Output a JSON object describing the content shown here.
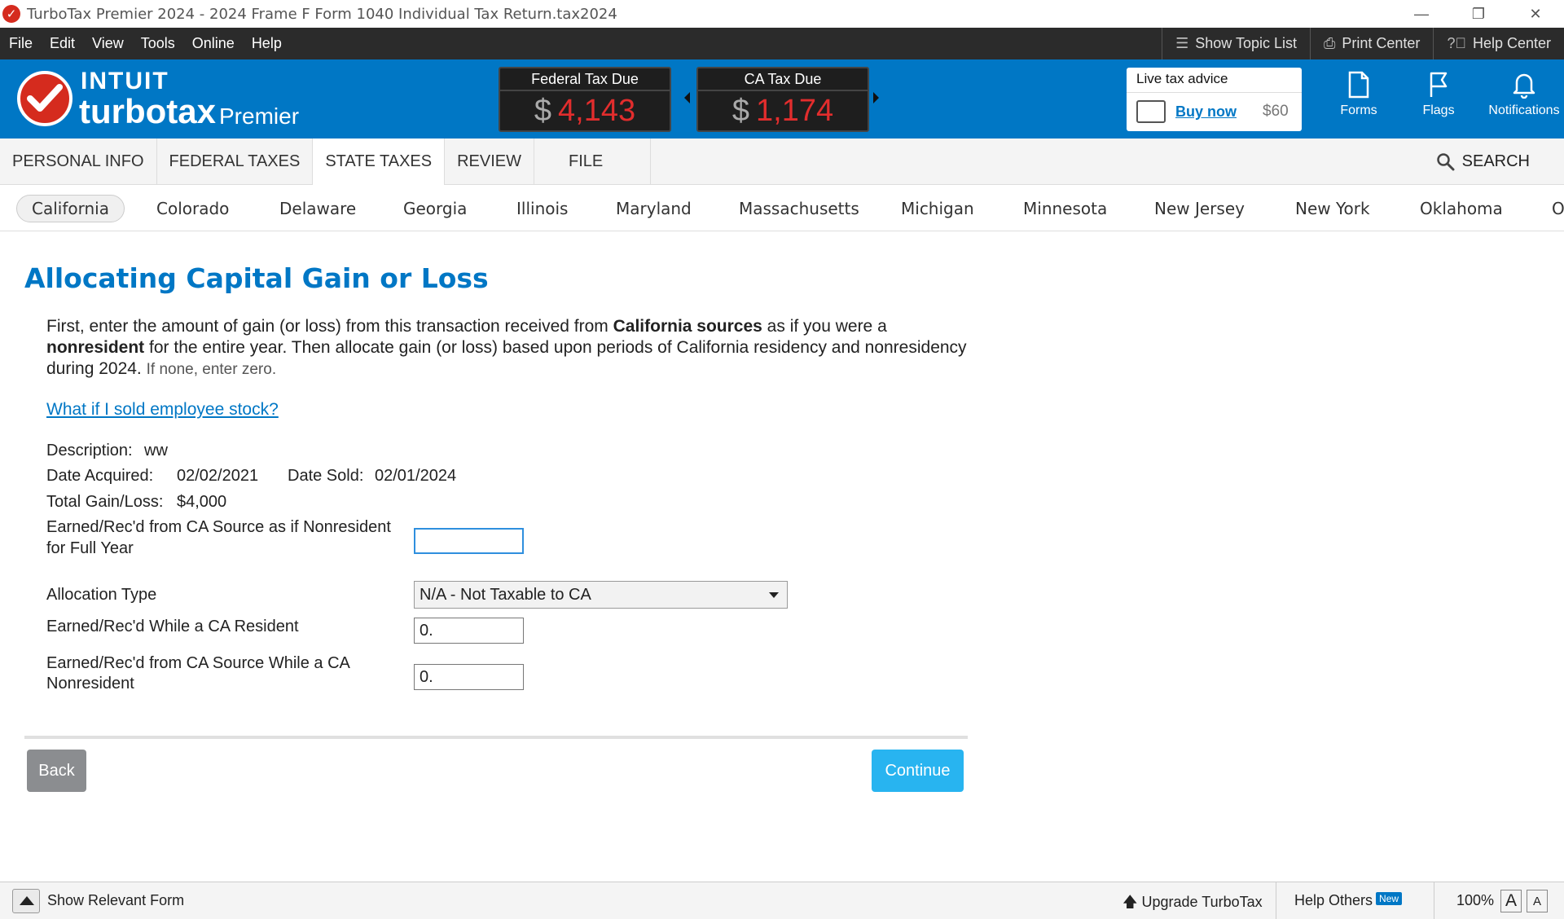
{
  "window": {
    "title": "TurboTax Premier 2024 - 2024 Frame F Form 1040  Individual Tax Return.tax2024",
    "controls": [
      "—",
      "❐",
      "✕"
    ]
  },
  "menu": {
    "items": [
      "File",
      "Edit",
      "View",
      "Tools",
      "Online",
      "Help"
    ],
    "show_topic_list": "Show Topic List",
    "print_center": "Print Center",
    "help_center": "Help Center"
  },
  "brand": {
    "intuit": "INTUIT",
    "turbotax": "turbotax",
    "edition": "Premier"
  },
  "tax_due": {
    "federal_label": "Federal Tax Due",
    "federal_currency": "$",
    "federal_amount": "4,143",
    "ca_label": "CA Tax Due",
    "ca_currency": "$",
    "ca_amount": "1,174",
    "amount_color": "#e22d2d"
  },
  "advice": {
    "title": "Live tax advice",
    "buy": "Buy now",
    "price": "$60"
  },
  "header_buttons": {
    "forms": "Forms",
    "flags": "Flags",
    "notifications": "Notifications"
  },
  "nav": {
    "tabs": [
      "PERSONAL INFO",
      "FEDERAL TAXES",
      "STATE TAXES",
      "REVIEW",
      "FILE"
    ],
    "active": "STATE TAXES",
    "search": "SEARCH"
  },
  "states": {
    "tabs": [
      "California",
      "Colorado",
      "Delaware",
      "Georgia",
      "Illinois",
      "Maryland",
      "Massachusetts",
      "Michigan",
      "Minnesota",
      "New Jersey",
      "New York",
      "Oklahoma",
      "O"
    ],
    "active": "California"
  },
  "page": {
    "title": "Allocating Capital Gain or Loss",
    "intro_1": "First, enter the amount of gain (or loss) from this transaction received from ",
    "intro_b1": "California sources",
    "intro_2": " as if you were a ",
    "intro_b2": "nonresident",
    "intro_3": " for the entire year. Then allocate gain (or loss) based upon periods of California residency and nonresidency during 2024. ",
    "intro_small": "If none, enter zero.",
    "help_link": "What if I sold employee stock?"
  },
  "details": {
    "description_label": "Description:",
    "description_value": "ww",
    "date_acquired_label": "Date Acquired:",
    "date_acquired_value": "02/02/2021",
    "date_sold_label": "Date Sold:",
    "date_sold_value": "02/01/2024",
    "total_label": "Total Gain/Loss:",
    "total_value": "$4,000"
  },
  "form": {
    "earned_nonres_label_1": "Earned/Rec'd from CA Source as if Nonresident",
    "earned_nonres_label_2": "for Full Year",
    "earned_nonres_value": "",
    "allocation_label": "Allocation Type",
    "allocation_value": "N/A - Not Taxable to CA",
    "while_res_label": "Earned/Rec'd While a CA Resident",
    "while_res_value": "0.",
    "while_nonres_label_1": "Earned/Rec'd from CA Source While a CA",
    "while_nonres_label_2": "Nonresident",
    "while_nonres_value": "0."
  },
  "buttons": {
    "back": "Back",
    "continue": "Continue"
  },
  "statusbar": {
    "show_relevant_form": "Show Relevant Form",
    "upgrade": "Upgrade TurboTax",
    "help_others": "Help Others",
    "new_badge": "New",
    "zoom": "100%",
    "font_large": "A",
    "font_small": "A"
  }
}
